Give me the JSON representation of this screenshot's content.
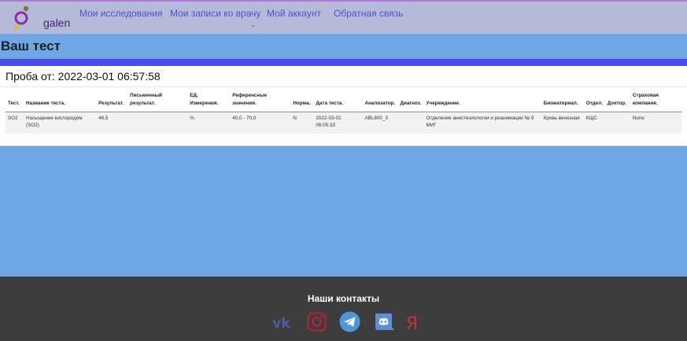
{
  "header": {
    "logo_text": "galen",
    "nav": [
      {
        "label": "Мои исследования"
      },
      {
        "label": "Мои записи ко врачу"
      },
      {
        "label": "Мой аккаунт"
      },
      {
        "label": "Обратная связь"
      }
    ],
    "dropdown_caret": "⌄"
  },
  "page": {
    "title": "Ваш тест"
  },
  "sample": {
    "title": "Проба от: 2022-03-01 06:57:58"
  },
  "table": {
    "columns": [
      "Тест.",
      "Название теста.",
      "Результат.",
      "Письменный результат.",
      "ЕД. Измерения.",
      "Референсные значения.",
      "Норма.",
      "Дата теста.",
      "Анализатор.",
      "Диагноз.",
      "Учереждение.",
      "Биоматериал.",
      "Отдел.",
      "Доктор.",
      "Страховая компания."
    ],
    "rows": [
      [
        "SO2",
        "Насыщение кислородом (SO2)",
        "46,5",
        "",
        "%",
        "40,0 - 70,0",
        "N",
        "2022-03-01 06:05:33",
        "ABL800_3",
        "",
        "Отделение анестезиологии и реанимации № 9 МИГ",
        "Кровь венозная",
        "КЩС",
        "",
        "None"
      ]
    ]
  },
  "footer": {
    "title": "Наши контакты",
    "social": [
      {
        "name": "vk",
        "icon": "vk-icon",
        "color": "#4a5ea3"
      },
      {
        "name": "instagram",
        "icon": "instagram-icon",
        "color": "#b1233b"
      },
      {
        "name": "telegram",
        "icon": "telegram-icon",
        "color": "#4d97d8"
      },
      {
        "name": "discord",
        "icon": "discord-icon",
        "color": "#5b8fd6"
      },
      {
        "name": "yandex",
        "icon": "yandex-icon",
        "color": "#c4323a"
      }
    ]
  },
  "colors": {
    "header_bg": "#b6bad9",
    "nav_link": "#4d4fd6",
    "page_bg": "#6ea7e3",
    "accent_bar": "#4a4cf0",
    "footer_bg": "#3d3d3d"
  }
}
